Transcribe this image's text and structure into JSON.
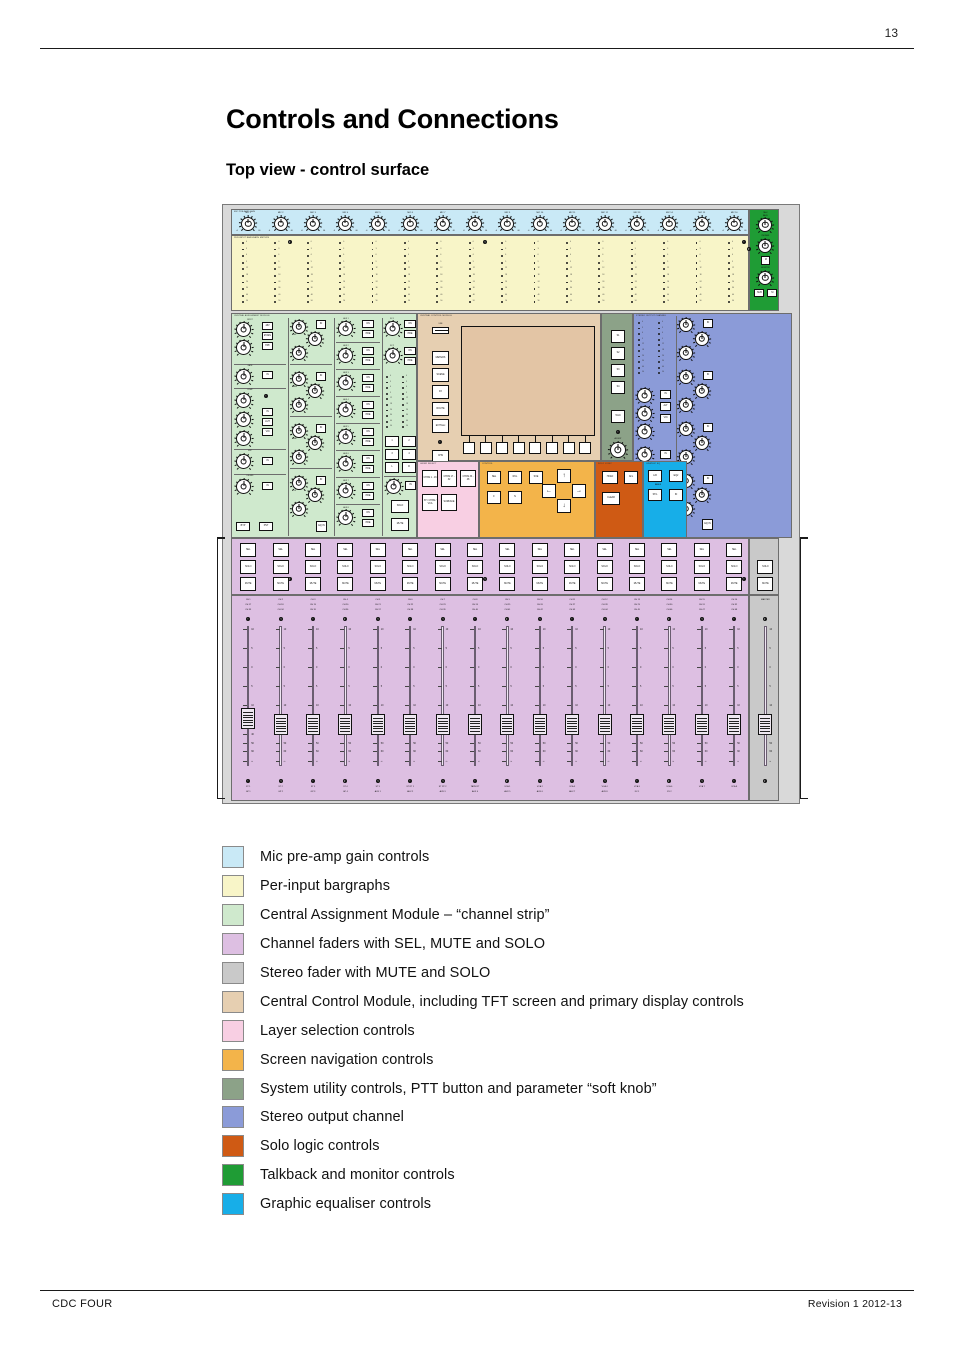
{
  "page": {
    "number": "13",
    "title": "Controls and Connections",
    "subtitle": "Top view - control surface",
    "footer_left": "CDC FOUR",
    "footer_right": "Revision 1 2012-13"
  },
  "legend": {
    "items": [
      {
        "color": "#c9e9f6",
        "label": "Mic pre-amp gain controls"
      },
      {
        "color": "#f8f5c8",
        "label": "Per-input bargraphs"
      },
      {
        "color": "#cfe9cd",
        "label": "Central Assignment Module – “channel strip”"
      },
      {
        "color": "#ddbfe2",
        "label": "Channel faders with SEL, MUTE and SOLO"
      },
      {
        "color": "#c9c9c9",
        "label": "Stereo fader with MUTE and SOLO"
      },
      {
        "color": "#e6cfb1",
        "label": "Central Control Module, including TFT screen and primary display controls"
      },
      {
        "color": "#f8cfe3",
        "label": "Layer selection controls"
      },
      {
        "color": "#f3b44a",
        "label": "Screen navigation controls"
      },
      {
        "color": "#8ca288",
        "label": "System utility controls, PTT button and parameter “soft knob”"
      },
      {
        "color": "#8b9bd8",
        "label": "Stereo output channel"
      },
      {
        "color": "#cf5a14",
        "label": "Solo logic controls"
      },
      {
        "color": "#1f9c35",
        "label": "Talkback and monitor controls"
      },
      {
        "color": "#17aee8",
        "label": "Graphic equaliser controls"
      }
    ]
  },
  "console": {
    "mic_section": {
      "zone_label": "MIC PRE-AMP GAIN",
      "channels": [
        "MIC 1",
        "MIC 2",
        "MIC 3",
        "MIC 4",
        "MIC 5",
        "MIC 6",
        "MIC 7",
        "MIC 8",
        "MIC 9",
        "MIC 10",
        "MIC 11",
        "MIC 12",
        "MIC 13",
        "MIC 14",
        "MIC 15",
        "MIC 16"
      ],
      "knob_min": "-6",
      "knob_max": "60"
    },
    "bargraph_section": {
      "zone_label": "PER-INPUT BARGRAPH METERS",
      "scale": [
        "0",
        "3",
        "6",
        "9",
        "12",
        "18",
        "24",
        "30",
        "40",
        "50"
      ]
    },
    "talkback_section": {
      "zone_label": "TALKBACK / MONITOR",
      "knobs": [
        "TALK BACK",
        "PHONES",
        "MONITOR"
      ],
      "buttons": [
        "M",
        "SUB",
        "M"
      ]
    },
    "cam_section": {
      "zone_label": "CENTRAL ASSIGNMENT MODULE",
      "column1": {
        "groups": [
          "INPUT",
          "GATE",
          "COMP",
          "EXP",
          "DE-ESS"
        ],
        "buttons": [
          "48V",
          "Ø REV",
          "HPF",
          "IN",
          "IN",
          "AUT",
          "VIN",
          "IN",
          "IN",
          "BYP",
          "PST"
        ]
      },
      "column2": {
        "groups": [
          "HF",
          "HMF",
          "LMF",
          "LF"
        ],
        "buttons": [
          "IN",
          "IN",
          "IN",
          "IN",
          "EQ IN"
        ]
      },
      "column3": {
        "sends": [
          "AUX 1",
          "AUX 2",
          "AUX 3",
          "AUX 4",
          "AUX 5",
          "AUX 6",
          "AUX 7",
          "AUX 8"
        ],
        "buttons": [
          "ON",
          "PRE"
        ]
      },
      "column4": {
        "fx": [
          "FX 1",
          "FX 2"
        ],
        "buttons": [
          "ON",
          "PRE"
        ],
        "routing": [
          "1",
          "2",
          "3",
          "4",
          "L",
          "R"
        ],
        "pan_button": "IN",
        "strip_buttons": [
          "SOLO",
          "MUTE"
        ]
      }
    },
    "ccm_section": {
      "zone_label": "CENTRAL CONTROL MODULE",
      "usb_label": "USB",
      "left_buttons": [
        "METERS",
        "SCENE",
        "FX",
        "ROUTE",
        "EXIT Esc"
      ],
      "chan_button": "CHN",
      "soft_key_count": 8
    },
    "util_section": {
      "zone_label": "SYSTEM UTILITY",
      "buttons": [
        "S1",
        "S2",
        "S3",
        "S4",
        "TALK"
      ],
      "soft_knob_label": "ADJUST"
    },
    "stereo_section": {
      "zone_label": "STEREO OUTPUT CHANNEL",
      "scale": [
        "0",
        "3",
        "6",
        "9",
        "12",
        "18",
        "24",
        "30",
        "40",
        "50"
      ],
      "buttons": [
        "IN",
        "ALT",
        "VIN",
        "IN",
        "GRD",
        "PST",
        "IN",
        "IN",
        "IN",
        "EQ IN"
      ]
    },
    "layer_section": {
      "zone_label": "LAYER SELECT",
      "buttons": [
        "CHNS 1 - 16",
        "CHNS 17 - 32",
        "CHNS 33 - 48",
        "ST / CHNS / VCA",
        "SURFACE"
      ]
    },
    "nav_section": {
      "zone_label": "CONTROL",
      "buttons": [
        "SEL",
        "RCL",
        "SVE",
        "F",
        "N",
        "COPY",
        "PASTE",
        "ENTER"
      ],
      "arrows": [
        "↑",
        "←",
        "→",
        "↓"
      ]
    },
    "solo_section": {
      "zone_label": "SOLO LOGIC",
      "buttons": [
        "HOLD",
        "AFL",
        "CLEAR"
      ]
    },
    "geq_section": {
      "zone_label": "GRAPHIC EQ",
      "sub_label": "BANDS",
      "buttons": [
        "L/R",
        "EQ2",
        "ST/L",
        "IN"
      ]
    },
    "channel_strip": {
      "buttons": [
        "SEL",
        "SOLO",
        "MUTE"
      ],
      "master_buttons": [
        "SOLO",
        "MUTE"
      ],
      "master_label": "MASTER",
      "columns": [
        {
          "top": [
            "CH 1",
            "CH 17",
            "CH 33"
          ],
          "bottom": [
            "ST 1",
            "GP 1"
          ]
        },
        {
          "top": [
            "CH 2",
            "CH 18",
            "CH 34"
          ],
          "bottom": [
            "ST 2",
            "GP 2"
          ]
        },
        {
          "top": [
            "CH 3",
            "CH 19",
            "CH 35"
          ],
          "bottom": [
            "ST 3",
            "GP 3"
          ]
        },
        {
          "top": [
            "CH 4",
            "CH 20",
            "CH 36"
          ],
          "bottom": [
            "ST 4",
            "GP 4"
          ]
        },
        {
          "top": [
            "CH 5",
            "CH 21",
            "CH 37"
          ],
          "bottom": [
            "ST 5",
            "AUX 1"
          ]
        },
        {
          "top": [
            "CH 6",
            "CH 22",
            "CH 38"
          ],
          "bottom": [
            "ST RT 1",
            "AUX 2"
          ]
        },
        {
          "top": [
            "CH 7",
            "CH 23",
            "CH 39"
          ],
          "bottom": [
            "ST RT 2",
            "AUX 3"
          ]
        },
        {
          "top": [
            "CH 8",
            "CH 24",
            "CH 40"
          ],
          "bottom": [
            "TAPE RT",
            "AUX 4"
          ]
        },
        {
          "top": [
            "CH 9",
            "CH 25",
            "CH 41"
          ],
          "bottom": [
            "VCA 1",
            "AUX 5"
          ]
        },
        {
          "top": [
            "CH 10",
            "CH 26",
            "CH 42"
          ],
          "bottom": [
            "VCA 2",
            "AUX 6"
          ]
        },
        {
          "top": [
            "CH 11",
            "CH 27",
            "CH 43"
          ],
          "bottom": [
            "VCA 3",
            "AUX 7"
          ]
        },
        {
          "top": [
            "CH 12",
            "CH 28",
            "CH 44"
          ],
          "bottom": [
            "VCA 4",
            "AUX 8"
          ]
        },
        {
          "top": [
            "CH 13",
            "CH 29",
            "CH 45"
          ],
          "bottom": [
            "VCA 5",
            "FX 1"
          ]
        },
        {
          "top": [
            "CH 14",
            "CH 30",
            "CH 46"
          ],
          "bottom": [
            "VCA 6",
            "FX 2"
          ]
        },
        {
          "top": [
            "CH 15",
            "CH 31",
            "CH 47"
          ],
          "bottom": [
            "VCA 7",
            ""
          ]
        },
        {
          "top": [
            "CH 16",
            "CH 32",
            "CH 48"
          ],
          "bottom": [
            "VCA 8",
            ""
          ]
        }
      ],
      "fader_scale": [
        "10",
        "5",
        "0",
        "5",
        "10",
        "20",
        "30",
        "40",
        "50",
        "60",
        "∞"
      ]
    }
  }
}
